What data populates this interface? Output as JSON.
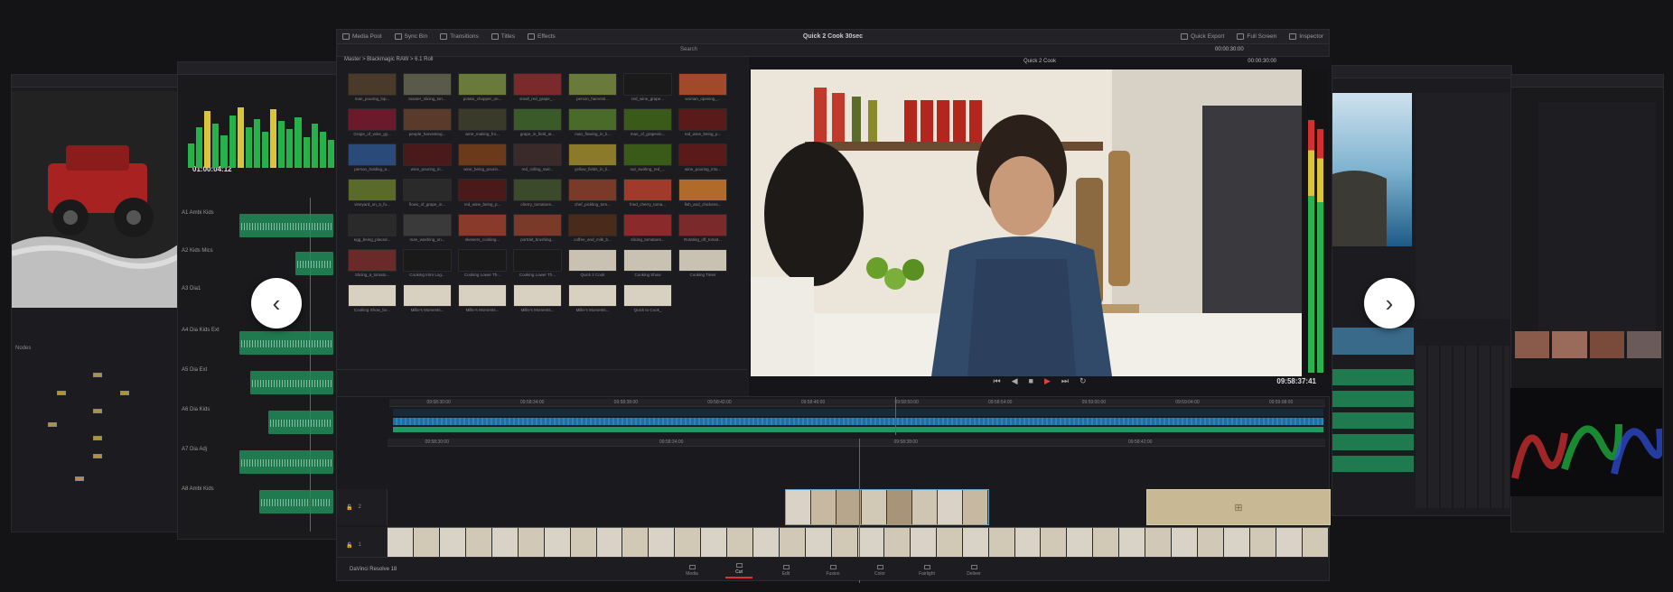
{
  "window": {
    "title": "Quick 2 Cook 30sec",
    "app_name": "DaVinci Resolve 18"
  },
  "toolbar": {
    "media_pool": "Media Pool",
    "sync_bin": "Sync Bin",
    "transitions": "Transitions",
    "titles": "Titles",
    "effects": "Effects",
    "quick_export": "Quick Export",
    "full_screen": "Full Screen",
    "inspector": "Inspector"
  },
  "subbar": {
    "search": "Search",
    "timecode": "00:00:30:00"
  },
  "media_pool": {
    "breadcrumb": "Master > Blackmagic RAW > 6.1 Roll",
    "clips": [
      {
        "name": "man_pouring_lop...",
        "color": "#4a3a2a"
      },
      {
        "name": "toaster_slicing_ton...",
        "color": "#5a5a4a"
      },
      {
        "name": "potato_chopper_on...",
        "color": "#6a7a3a"
      },
      {
        "name": "small_red_grape_...",
        "color": "#7a2a2a"
      },
      {
        "name": "person_harvesti...",
        "color": "#6a7a3a"
      },
      {
        "name": "red_wine_grape...",
        "color": "#1a1a1a"
      },
      {
        "name": "woman_opening_...",
        "color": "#a04a2a"
      },
      {
        "name": "Grape_of_wine_gy...",
        "color": "#6a1a2a"
      },
      {
        "name": "people_harvesting...",
        "color": "#5a3a2a"
      },
      {
        "name": "wine_making_fro...",
        "color": "#3a3a2a"
      },
      {
        "name": "grape_in_field_at...",
        "color": "#3a5a2a"
      },
      {
        "name": "man_flowing_in_li...",
        "color": "#4a6a2a"
      },
      {
        "name": "man_of_grapevin...",
        "color": "#3a5a1a"
      },
      {
        "name": "red_wine_being_p...",
        "color": "#5a1a1a"
      },
      {
        "name": "person_holding_a...",
        "color": "#2a4a7a"
      },
      {
        "name": "wine_pouring_in...",
        "color": "#4a1a1a"
      },
      {
        "name": "wine_being_pourin...",
        "color": "#6a3a1a"
      },
      {
        "name": "red_rolling_swir...",
        "color": "#3a2a2a"
      },
      {
        "name": "yellow_fields_in_li...",
        "color": "#8a7a2a"
      },
      {
        "name": "out_swirling_red_...",
        "color": "#3a5a1a"
      },
      {
        "name": "wine_pouring_into...",
        "color": "#5a1a1a"
      },
      {
        "name": "vineyard_on_a_fu...",
        "color": "#5a6a2a"
      },
      {
        "name": "flows_of_grape_in...",
        "color": "#2a2a2a"
      },
      {
        "name": "red_wine_being_p...",
        "color": "#4a1a1a"
      },
      {
        "name": "cherry_tomatoes...",
        "color": "#3a4a2a"
      },
      {
        "name": "chef_pickling_tom...",
        "color": "#7a3a2a"
      },
      {
        "name": "fried_cherry_toma...",
        "color": "#a03a2a"
      },
      {
        "name": "fish_and_chickens...",
        "color": "#b06a2a"
      },
      {
        "name": "egg_being_placed...",
        "color": "#2a2a2a"
      },
      {
        "name": "man_washing_on...",
        "color": "#3a3a3a"
      },
      {
        "name": "skewers_cooking...",
        "color": "#8a3a2a"
      },
      {
        "name": "portrait_brushing...",
        "color": "#7a3a2a"
      },
      {
        "name": "coffee_and_milk_b...",
        "color": "#4a2a1a"
      },
      {
        "name": "slicing_tomatoes...",
        "color": "#8a2a2a"
      },
      {
        "name": "Rotating_off_tomat...",
        "color": "#7a2a2a"
      },
      {
        "name": "Slicing_a_tomato...",
        "color": "#6a2a2a"
      },
      {
        "name": "Cooking Intro Log...",
        "color": "#1a1a1a"
      },
      {
        "name": "Cooking Lower Th...",
        "color": "#1a1a1a"
      },
      {
        "name": "Cooking Lower Th...",
        "color": "#1a1a1a"
      },
      {
        "name": "Quick 2 Cook",
        "color": "#c9c2b2"
      },
      {
        "name": "Cooking Show",
        "color": "#c9c2b2"
      },
      {
        "name": "Cooking Timer",
        "color": "#c9c2b2"
      },
      {
        "name": "Cooking Show_bo...",
        "color": "#d8d0c0"
      },
      {
        "name": "Millie's Moments...",
        "color": "#d8d0c0"
      },
      {
        "name": "Millie's Moments...",
        "color": "#d8d0c0"
      },
      {
        "name": "Millie's Moments...",
        "color": "#d8d0c0"
      },
      {
        "name": "Millie's Moments...",
        "color": "#d8d0c0"
      },
      {
        "name": "Quick to Cook_",
        "color": "#d8d0c0"
      }
    ]
  },
  "viewer": {
    "title": "Quick 2 Cook",
    "timecode_top": "00:00:30:00",
    "timecode": "09:58:37:41"
  },
  "timeline": {
    "ruler_top": [
      "09:58:30:00",
      "09:58:34:00",
      "09:58:38:00",
      "09:58:42:00",
      "09:58:46:00",
      "09:58:50:00",
      "09:58:54:00",
      "09:59:00:00",
      "09:59:04:00",
      "09:59:08:00"
    ],
    "ruler_main": [
      "09:58:30:00",
      "09:58:34:00",
      "09:58:38:00",
      "09:58:42:00"
    ],
    "track_v2": "2",
    "track_v1": "1",
    "track_a1": "A1"
  },
  "pages": [
    {
      "label": "Media",
      "active": false
    },
    {
      "label": "Cut",
      "active": true
    },
    {
      "label": "Edit",
      "active": false
    },
    {
      "label": "Fusion",
      "active": false
    },
    {
      "label": "Color",
      "active": false
    },
    {
      "label": "Fairlight",
      "active": false
    },
    {
      "label": "Deliver",
      "active": false
    }
  ],
  "fairlight": {
    "timecode": "01:00:04:12",
    "tracks": [
      "A1 Ambi Kids",
      "A2 Kids Mics",
      "A3 Dia1",
      "A4 Dia Kids Ext",
      "A5 Dia Ext",
      "A6 Dia Kids",
      "A7 Dia Adj",
      "A8 Ambi Kids",
      "A9 Audio Fx"
    ]
  },
  "fusion": {
    "label": "Nodes"
  },
  "colors": {
    "accent_red": "#e03030",
    "audio_green": "#1f9a63",
    "video_blue": "#2a86bd"
  }
}
